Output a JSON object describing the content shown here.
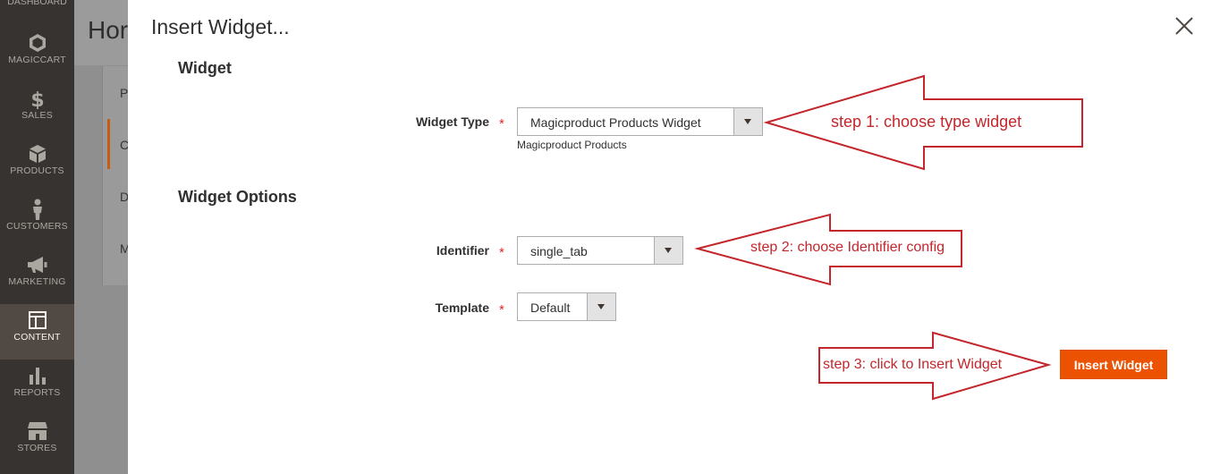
{
  "sidebar": {
    "top_partial_label": "DASHBOARD",
    "items": [
      {
        "label": "MAGICCART",
        "icon": "hexagon-icon"
      },
      {
        "label": "SALES",
        "icon": "dollar-icon"
      },
      {
        "label": "PRODUCTS",
        "icon": "cube-icon"
      },
      {
        "label": "CUSTOMERS",
        "icon": "person-icon"
      },
      {
        "label": "MARKETING",
        "icon": "megaphone-icon"
      },
      {
        "label": "CONTENT",
        "icon": "layout-icon",
        "active": true
      },
      {
        "label": "REPORTS",
        "icon": "bar-chart-icon"
      },
      {
        "label": "STORES",
        "icon": "storefront-icon"
      }
    ]
  },
  "background_page": {
    "title_partial": "Hor",
    "panel_items": [
      "P",
      "C",
      "D",
      "M"
    ]
  },
  "modal": {
    "title": "Insert Widget...",
    "sections": {
      "widget": "Widget",
      "options": "Widget Options"
    },
    "fields": {
      "widget_type": {
        "label": "Widget Type",
        "value": "Magicproduct Products Widget",
        "note": "Magicproduct Products",
        "required": "*"
      },
      "identifier": {
        "label": "Identifier",
        "value": "single_tab",
        "required": "*"
      },
      "template": {
        "label": "Template",
        "value": "Default",
        "required": "*"
      }
    },
    "insert_button": "Insert Widget"
  },
  "annotations": {
    "step1": "step 1: choose type widget",
    "step2": "step 2: choose Identifier config",
    "step3": "step 3: click to Insert Widget"
  },
  "colors": {
    "sidebar_bg": "#373330",
    "sidebar_active": "#514943",
    "accent": "#eb5202",
    "annotation": "#c3262b"
  }
}
